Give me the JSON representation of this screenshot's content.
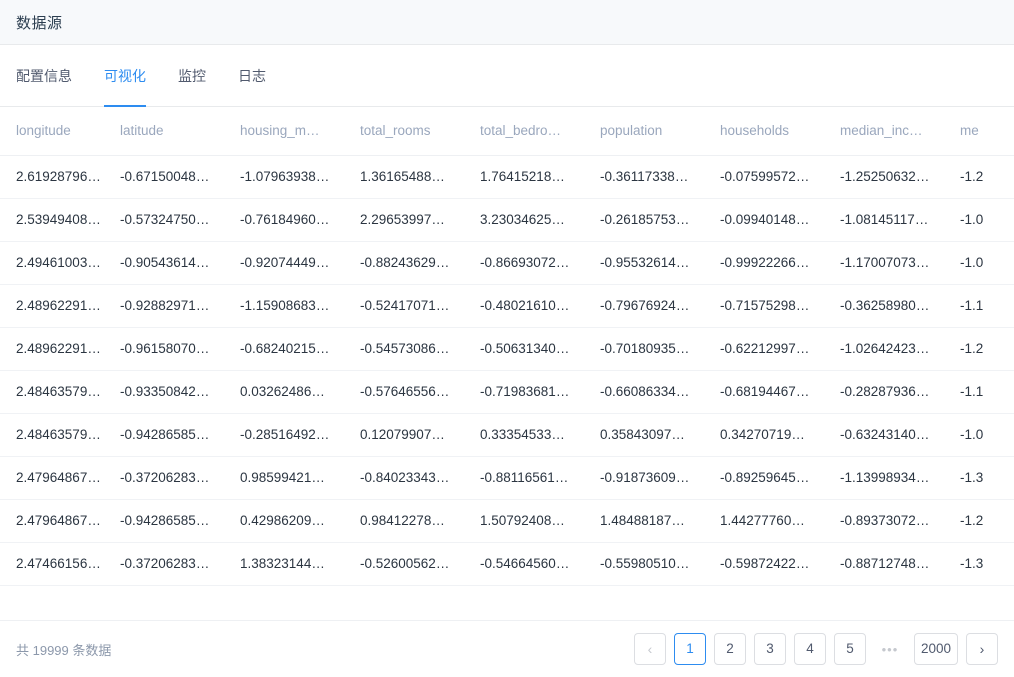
{
  "header": {
    "title": "数据源"
  },
  "tabs": [
    {
      "label": "配置信息",
      "active": false
    },
    {
      "label": "可视化",
      "active": true
    },
    {
      "label": "监控",
      "active": false
    },
    {
      "label": "日志",
      "active": false
    }
  ],
  "table": {
    "columns": [
      "longitude",
      "latitude",
      "housing_m…",
      "total_rooms",
      "total_bedro…",
      "population",
      "households",
      "median_inc…",
      "me"
    ],
    "rows": [
      [
        "2.61928796…",
        "-0.67150048…",
        "-1.07963938…",
        "1.36165488…",
        "1.76415218…",
        "-0.36117338…",
        "-0.07599572…",
        "-1.25250632…",
        "-1.2"
      ],
      [
        "2.53949408…",
        "-0.57324750…",
        "-0.76184960…",
        "2.29653997…",
        "3.23034625…",
        "-0.26185753…",
        "-0.09940148…",
        "-1.08145117…",
        "-1.0"
      ],
      [
        "2.49461003…",
        "-0.90543614…",
        "-0.92074449…",
        "-0.88243629…",
        "-0.86693072…",
        "-0.95532614…",
        "-0.99922266…",
        "-1.17007073…",
        "-1.0"
      ],
      [
        "2.48962291…",
        "-0.92882971…",
        "-1.15908683…",
        "-0.52417071…",
        "-0.48021610…",
        "-0.79676924…",
        "-0.71575298…",
        "-0.36258980…",
        "-1.1"
      ],
      [
        "2.48962291…",
        "-0.96158070…",
        "-0.68240215…",
        "-0.54573086…",
        "-0.50631340…",
        "-0.70180935…",
        "-0.62212997…",
        "-1.02642423…",
        "-1.2"
      ],
      [
        "2.48463579…",
        "-0.93350842…",
        "0.03262486…",
        "-0.57646556…",
        "-0.71983681…",
        "-0.66086334…",
        "-0.68194467…",
        "-0.28287936…",
        "-1.1"
      ],
      [
        "2.48463579…",
        "-0.94286585…",
        "-0.28516492…",
        "0.12079907…",
        "0.33354533…",
        "0.35843097…",
        "0.34270719…",
        "-0.63243140…",
        "-1.0"
      ],
      [
        "2.47964867…",
        "-0.37206283…",
        "0.98599421…",
        "-0.84023343…",
        "-0.88116561…",
        "-0.91873609…",
        "-0.89259645…",
        "-1.13998934…",
        "-1.3"
      ],
      [
        "2.47964867…",
        "-0.94286585…",
        "0.42986209…",
        "0.98412278…",
        "1.50792408…",
        "1.48488187…",
        "1.44277760…",
        "-0.89373072…",
        "-1.2"
      ],
      [
        "2.47466156…",
        "-0.37206283…",
        "1.38323144…",
        "-0.52600562…",
        "-0.54664560…",
        "-0.55980510…",
        "-0.59872422…",
        "-0.88712748…",
        "-1.3"
      ]
    ]
  },
  "footer": {
    "total_text": "共 19999 条数据",
    "pagination": {
      "prev_icon": "chevron-left-icon",
      "next_icon": "chevron-right-icon",
      "prev_glyph": "‹",
      "next_glyph": "›",
      "ellipsis": "•••",
      "pages": [
        "1",
        "2",
        "3",
        "4",
        "5"
      ],
      "current": "1",
      "last_page": "2000"
    }
  },
  "colors": {
    "accent": "#2d8cf0",
    "header_bg": "#f7f9fb",
    "text": "#2b3541",
    "muted": "#9aa7bd",
    "border": "#e8eaec"
  }
}
